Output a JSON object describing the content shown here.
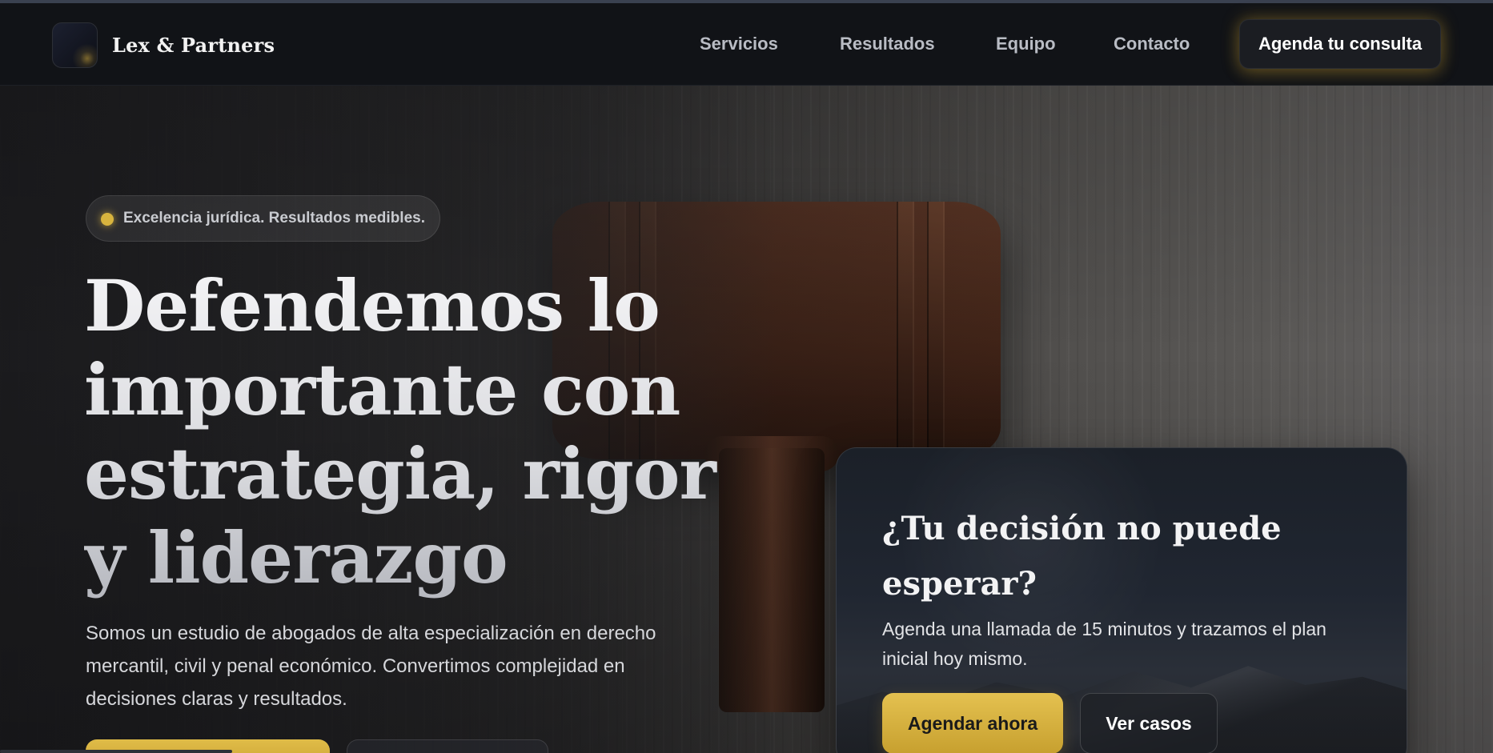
{
  "brand": {
    "name": "Lex & Partners",
    "logo_icon": "logo-mark-icon"
  },
  "nav": {
    "links": [
      "Servicios",
      "Resultados",
      "Equipo",
      "Contacto"
    ],
    "cta_label": "Agenda tu consulta"
  },
  "hero": {
    "badge_text": "Excelencia jurídica. Resultados medibles.",
    "headline": "Defendemos lo importante con estrategia, rigor y liderazgo",
    "lead": "Somos un estudio de abogados de alta especialización en derecho mercantil, civil y penal económico. Convertimos complejidad en decisiones claras y resultados.",
    "background_image": "wooden-gavel-on-wood-table"
  },
  "cta_card": {
    "title": "¿Tu decisión no puede esperar?",
    "text": "Agenda una llamada de 15 minutos y trazamos el plan inicial hoy mismo.",
    "primary_label": "Agendar ahora",
    "secondary_label": "Ver casos"
  },
  "colors": {
    "accent_gold": "#d8b43e",
    "nav_background": "#111317",
    "text_primary": "#e9e9ec"
  }
}
